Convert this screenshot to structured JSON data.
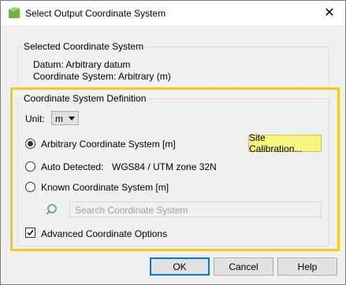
{
  "window": {
    "title": "Select Output Coordinate System",
    "close_glyph": "✕"
  },
  "selected_group": {
    "label": "Selected Coordinate System",
    "datum": "Datum: Arbitrary datum",
    "coordinate_system": "Coordinate System: Arbitrary (m)"
  },
  "definition_group": {
    "label": "Coordinate System Definition",
    "unit_label": "Unit:",
    "unit_value": "m",
    "options": [
      {
        "label": "Arbitrary Coordinate System [m]",
        "checked": true
      },
      {
        "label": "Auto Detected:",
        "checked": false,
        "detail": "WGS84 / UTM zone 32N"
      },
      {
        "label": "Known Coordinate System [m]",
        "checked": false
      }
    ],
    "site_calibration_button": "Site Calibration...",
    "search_placeholder": "Search Coordinate System",
    "advanced_label": "Advanced Coordinate Options",
    "advanced_checked": true
  },
  "footer": {
    "ok": "OK",
    "cancel": "Cancel",
    "help": "Help"
  },
  "colors": {
    "highlight_border": "#f7c910",
    "site_calibration_bg": "#f5f580",
    "default_button_border": "#0078d7"
  },
  "icons": {
    "app": "app-logo-icon",
    "close": "close-icon",
    "search": "search-icon",
    "combo_arrow": "chevron-down-icon",
    "check": "checkmark-icon"
  }
}
